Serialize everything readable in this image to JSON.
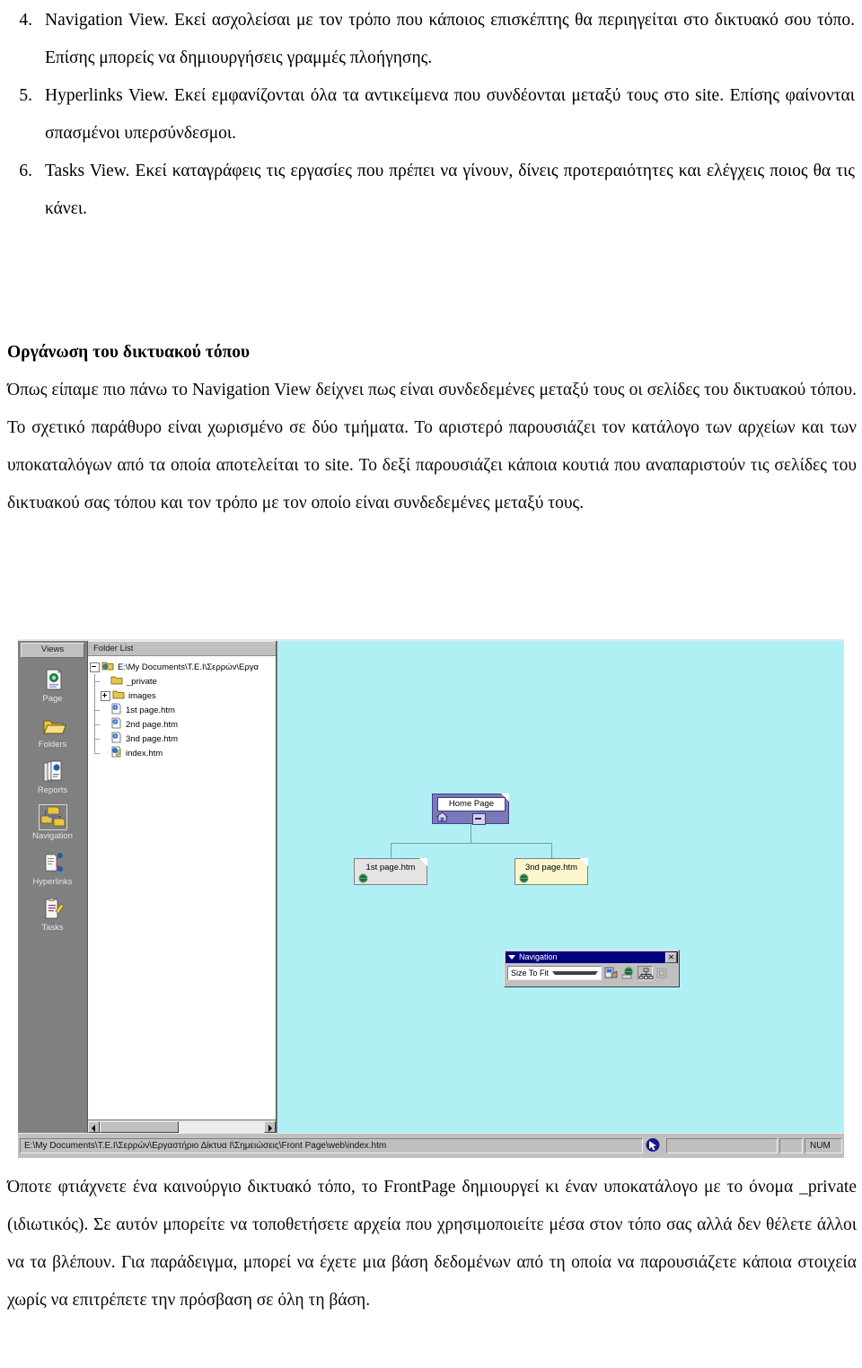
{
  "document": {
    "list_items": [
      {
        "number": "4.",
        "text": "Navigation View. Εκεί ασχολείσαι με τον τρόπο που κάποιος επισκέπτης θα περιηγείται στο δικτυακό σου τόπο. Επίσης μπορείς να δημιουργήσεις γραμμές πλοήγησης."
      },
      {
        "number": "5.",
        "text": "Hyperlinks View. Εκεί εμφανίζονται όλα τα αντικείμενα που συνδέονται μεταξύ τους στο site. Επίσης φαίνονται σπασμένοι υπερσύνδεσμοι."
      },
      {
        "number": "6.",
        "text": "Tasks View. Εκεί καταγράφεις τις εργασίες που πρέπει να γίνουν, δίνεις προτεραιότητες και ελέγχεις ποιος θα τις κάνει."
      }
    ],
    "section_heading": "Οργάνωση του δικτυακού τόπου",
    "paragraph_1": "Όπως είπαμε πιο πάνω το Navigation View δείχνει πως είναι συνδεδεμένες μεταξύ τους οι σελίδες του δικτυακού τόπου. Το σχετικό παράθυρο είναι χωρισμένο σε δύο τμήματα. Το αριστερό παρουσιάζει τον κατάλογο των αρχείων και των υποκαταλόγων από τα οποία αποτελείται το site. Το δεξί παρουσιάζει κάποια κουτιά που αναπαριστούν τις σελίδες του δικτυακού σας τόπου και τον τρόπο με τον οποίο είναι συνδεδεμένες μεταξύ τους.",
    "paragraph_2": "Όποτε φτιάχνετε ένα καινούργιο δικτυακό τόπο, το FrontPage δημιουργεί κι έναν υποκατάλογο με το όνομα _private (ιδιωτικός). Σε αυτόν μπορείτε να τοποθετήσετε αρχεία που χρησιμοποιείτε μέσα στον τόπο σας αλλά δεν θέλετε άλλοι να τα βλέπουν. Για παράδειγμα, μπορεί να έχετε μια βάση δεδομένων από τη οποία να παρουσιάζετε κάποια στοιχεία χωρίς να επιτρέπετε την πρόσβαση σε όλη τη βάση."
  },
  "screenshot": {
    "views_bar": {
      "header": "Views",
      "items": [
        {
          "label": "Page",
          "icon": "page-view-icon",
          "selected": false
        },
        {
          "label": "Folders",
          "icon": "folders-view-icon",
          "selected": false
        },
        {
          "label": "Reports",
          "icon": "reports-view-icon",
          "selected": false
        },
        {
          "label": "Navigation",
          "icon": "navigation-view-icon",
          "selected": true
        },
        {
          "label": "Hyperlinks",
          "icon": "hyperlinks-view-icon",
          "selected": false
        },
        {
          "label": "Tasks",
          "icon": "tasks-view-icon",
          "selected": false
        }
      ]
    },
    "folder_list": {
      "header": "Folder List",
      "tree": [
        {
          "label": "E:\\My Documents\\T.E.I\\Σερρών\\Εργα",
          "icon": "web-root-folder-icon",
          "level": 0,
          "expander": "minus"
        },
        {
          "label": "_private",
          "icon": "folder-icon",
          "level": 1,
          "expander": "none"
        },
        {
          "label": "images",
          "icon": "folder-icon",
          "level": 1,
          "expander": "plus"
        },
        {
          "label": "1st page.htm",
          "icon": "html-page-icon",
          "level": 1,
          "expander": "none"
        },
        {
          "label": "2nd page.htm",
          "icon": "html-page-icon",
          "level": 1,
          "expander": "none"
        },
        {
          "label": "3nd page.htm",
          "icon": "html-page-icon",
          "level": 1,
          "expander": "none"
        },
        {
          "label": "index.htm",
          "icon": "html-page-open-icon",
          "level": 1,
          "expander": "none"
        }
      ]
    },
    "navigation_canvas": {
      "background_color": "#b0f0f4",
      "nodes": [
        {
          "label": "Home Page",
          "type": "home",
          "icon": "home-icon",
          "fill": "#7a77ba"
        },
        {
          "label": "1st page.htm",
          "type": "child",
          "icon": "globe-icon",
          "fill": "#e4e4e4"
        },
        {
          "label": "3nd page.htm",
          "type": "child",
          "icon": "globe-icon",
          "fill": "#fdf6cd"
        }
      ],
      "collapse_button": "minus"
    },
    "navigation_toolbar": {
      "title": "Navigation",
      "close_label": "✕",
      "zoom_value": "Size To Fit",
      "buttons": [
        {
          "name": "portrait-landscape-icon"
        },
        {
          "name": "view-subtree-globe-icon"
        },
        {
          "name": "hierarchy-tree-icon"
        },
        {
          "name": "external-link-icon"
        }
      ]
    },
    "status_bar": {
      "path": "E:\\My Documents\\T.E.I\\Σερρών\\Εργαστήριο Δίκτυα Ι\\Σημειώσεις\\Front Page\\web\\index.htm",
      "indicator_icon": "frontpage-server-icon",
      "num_lock": "NUM"
    }
  }
}
